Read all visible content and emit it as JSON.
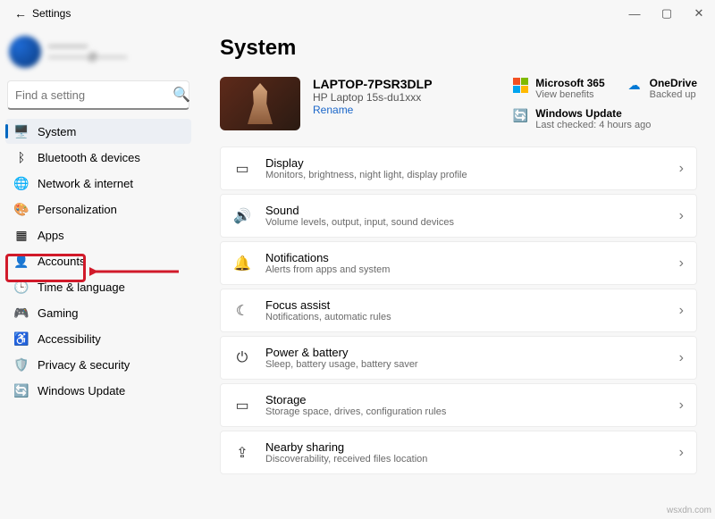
{
  "window": {
    "title": "Settings"
  },
  "profile": {
    "name": "————",
    "email": "————@———"
  },
  "search": {
    "placeholder": "Find a setting"
  },
  "sidebar": {
    "items": [
      {
        "label": "System",
        "icon": "🖥️"
      },
      {
        "label": "Bluetooth & devices",
        "icon": "ᛒ"
      },
      {
        "label": "Network & internet",
        "icon": "🌐"
      },
      {
        "label": "Personalization",
        "icon": "🎨"
      },
      {
        "label": "Apps",
        "icon": "▦"
      },
      {
        "label": "Accounts",
        "icon": "👤"
      },
      {
        "label": "Time & language",
        "icon": "🕒"
      },
      {
        "label": "Gaming",
        "icon": "🎮"
      },
      {
        "label": "Accessibility",
        "icon": "♿"
      },
      {
        "label": "Privacy & security",
        "icon": "🛡️"
      },
      {
        "label": "Windows Update",
        "icon": "🔄"
      }
    ]
  },
  "main": {
    "heading": "System",
    "device": {
      "name": "LAPTOP-7PSR3DLP",
      "model": "HP Laptop 15s-du1xxx",
      "rename": "Rename"
    },
    "status": {
      "ms365": {
        "label": "Microsoft 365",
        "sub": "View benefits"
      },
      "onedrive": {
        "label": "OneDrive",
        "sub": "Backed up"
      },
      "update": {
        "label": "Windows Update",
        "sub": "Last checked: 4 hours ago"
      }
    },
    "cards": [
      {
        "title": "Display",
        "sub": "Monitors, brightness, night light, display profile",
        "icon": "▭"
      },
      {
        "title": "Sound",
        "sub": "Volume levels, output, input, sound devices",
        "icon": "🔊"
      },
      {
        "title": "Notifications",
        "sub": "Alerts from apps and system",
        "icon": "🔔"
      },
      {
        "title": "Focus assist",
        "sub": "Notifications, automatic rules",
        "icon": "☾"
      },
      {
        "title": "Power & battery",
        "sub": "Sleep, battery usage, battery saver",
        "icon": "⏻"
      },
      {
        "title": "Storage",
        "sub": "Storage space, drives, configuration rules",
        "icon": "▭"
      },
      {
        "title": "Nearby sharing",
        "sub": "Discoverability, received files location",
        "icon": "⇪"
      }
    ]
  },
  "watermark": "wsxdn.com"
}
